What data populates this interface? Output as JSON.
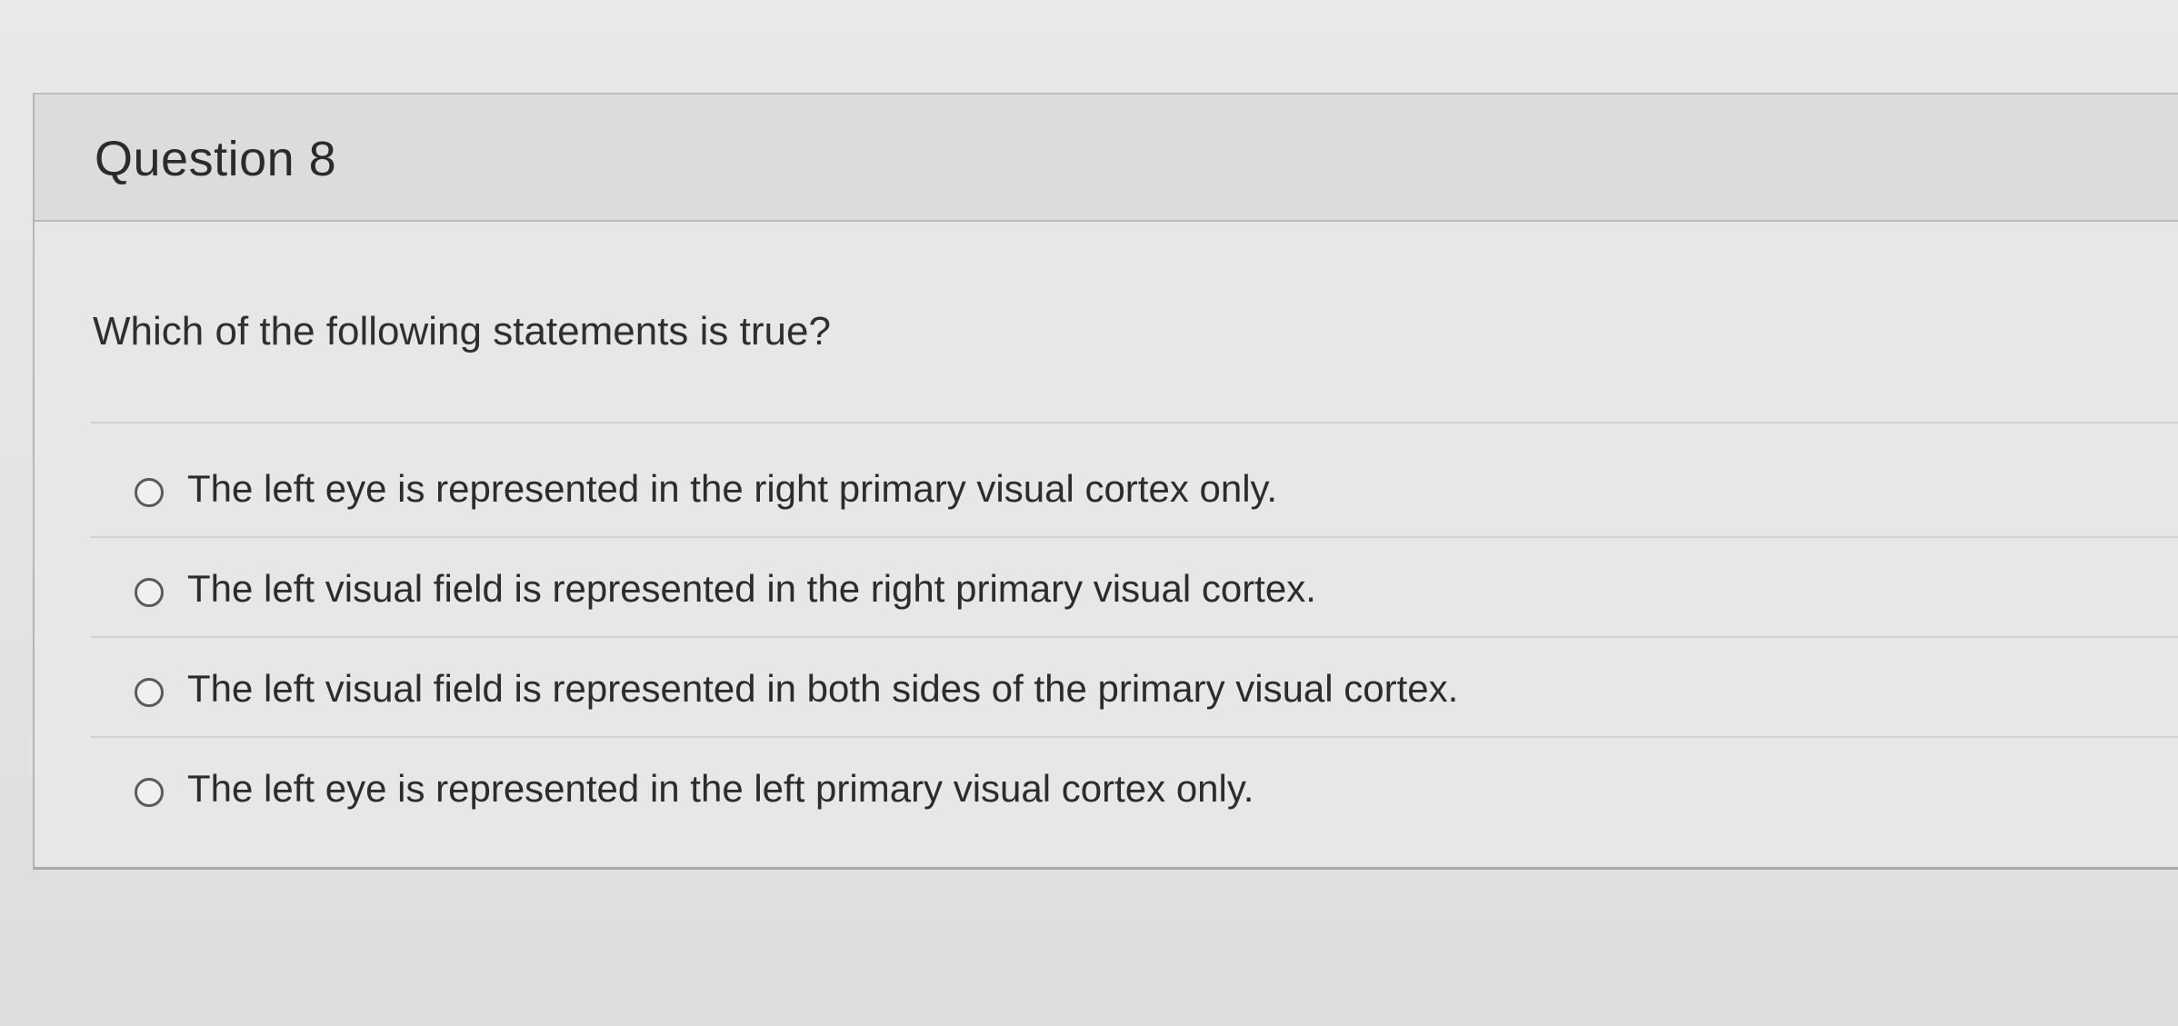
{
  "question": {
    "title": "Question 8",
    "prompt": "Which of the following statements is true?",
    "options": [
      {
        "label": "The left eye is represented in the right primary visual cortex only."
      },
      {
        "label": "The left visual field is represented in the right primary visual cortex."
      },
      {
        "label": "The left visual field is represented in both sides of the primary visual cortex."
      },
      {
        "label": "The left eye is represented in the left primary visual cortex only."
      }
    ]
  }
}
